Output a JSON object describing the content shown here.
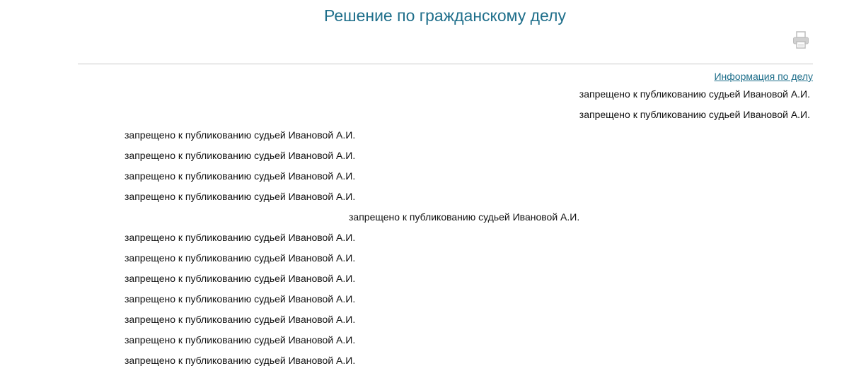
{
  "page": {
    "title": "Решение по гражданскому делу",
    "case_info_link": "Информация по делу"
  },
  "toolbar": {
    "print_icon": "printer-icon"
  },
  "colors": {
    "title": "#1f6f8b",
    "link": "#1f6f8b",
    "divider": "#c8c8c8",
    "text": "#111111"
  },
  "document": {
    "lines": [
      {
        "text": "запрещено к публикованию судьей Ивановой А.И.",
        "align": "right"
      },
      {
        "text": "запрещено к публикованию судьей Ивановой А.И.",
        "align": "right"
      },
      {
        "text": "запрещено к публикованию судьей Ивановой А.И.",
        "align": "left"
      },
      {
        "text": "запрещено к публикованию судьей Ивановой А.И.",
        "align": "left"
      },
      {
        "text": "запрещено к публикованию судьей Ивановой А.И.",
        "align": "left"
      },
      {
        "text": "запрещено к публикованию судьей Ивановой А.И.",
        "align": "left"
      },
      {
        "text": "запрещено к публикованию судьей Ивановой А.И.",
        "align": "center"
      },
      {
        "text": "запрещено к публикованию судьей Ивановой А.И.",
        "align": "left"
      },
      {
        "text": "запрещено к публикованию судьей Ивановой А.И.",
        "align": "left"
      },
      {
        "text": "запрещено к публикованию судьей Ивановой А.И.",
        "align": "left"
      },
      {
        "text": "запрещено к публикованию судьей Ивановой А.И.",
        "align": "left"
      },
      {
        "text": "запрещено к публикованию судьей Ивановой А.И.",
        "align": "left"
      },
      {
        "text": "запрещено к публикованию судьей Ивановой А.И.",
        "align": "left"
      },
      {
        "text": "запрещено к публикованию судьей Ивановой А.И.",
        "align": "left"
      }
    ]
  }
}
